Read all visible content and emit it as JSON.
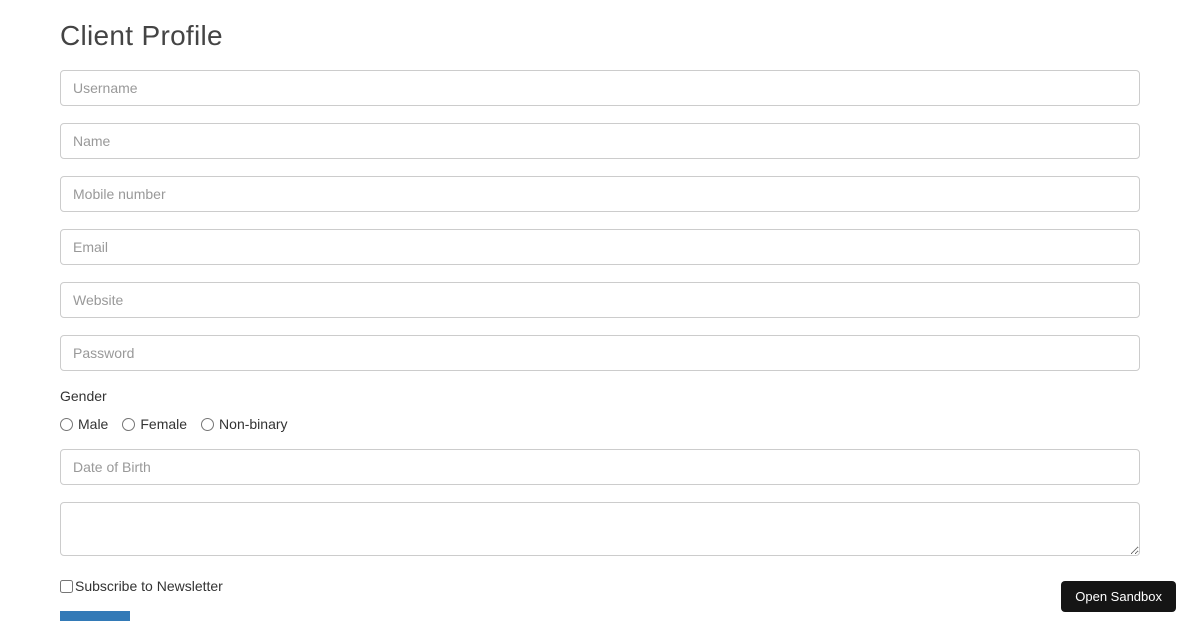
{
  "title": "Client Profile",
  "fields": {
    "username": {
      "placeholder": "Username",
      "value": ""
    },
    "name": {
      "placeholder": "Name",
      "value": ""
    },
    "mobile": {
      "placeholder": "Mobile number",
      "value": ""
    },
    "email": {
      "placeholder": "Email",
      "value": ""
    },
    "website": {
      "placeholder": "Website",
      "value": ""
    },
    "password": {
      "placeholder": "Password",
      "value": ""
    },
    "dob": {
      "placeholder": "Date of Birth",
      "value": ""
    },
    "textarea": {
      "placeholder": "",
      "value": ""
    }
  },
  "gender": {
    "label": "Gender",
    "options": {
      "male": "Male",
      "female": "Female",
      "nonbinary": "Non-binary"
    }
  },
  "newsletter": {
    "label": "Subscribe to Newsletter"
  },
  "sandbox": {
    "label": "Open Sandbox"
  }
}
